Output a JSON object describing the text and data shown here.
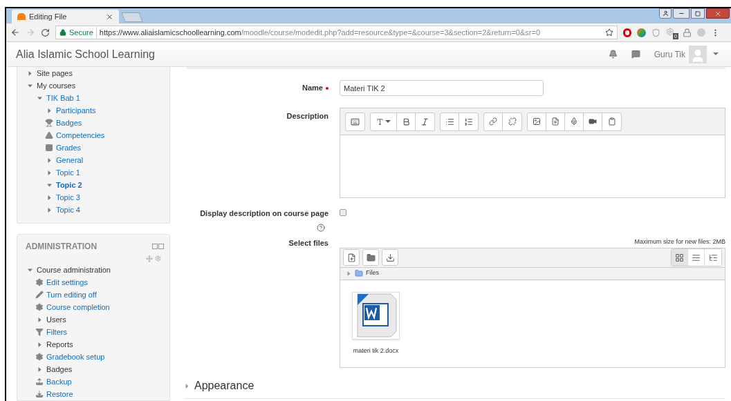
{
  "browser": {
    "tab_title": "Editing File",
    "secure_label": "Secure",
    "url_host": "https://www.aliaislamicschoollearning.com",
    "url_path": "/moodle/course/modedit.php?add=resource&type=&course=3&section=2&return=0&sr=0",
    "extension_badge": "0"
  },
  "site": {
    "title": "Alia Islamic School Learning",
    "user_name": "Guru Tik"
  },
  "navigation": [
    {
      "label": "Site pages",
      "kind": "node",
      "expanded": false,
      "link": false,
      "selected": false
    },
    {
      "label": "My courses",
      "kind": "node",
      "expanded": true,
      "link": false,
      "selected": false,
      "children": [
        {
          "label": "TIK Bab 1",
          "kind": "node",
          "expanded": true,
          "link": true,
          "selected": false,
          "children": [
            {
              "label": "Participants",
              "kind": "node",
              "expanded": false,
              "link": true,
              "selected": false
            },
            {
              "label": "Badges",
              "kind": "trophy",
              "link": true,
              "selected": false
            },
            {
              "label": "Competencies",
              "kind": "pyramid",
              "link": true,
              "selected": false
            },
            {
              "label": "Grades",
              "kind": "table",
              "link": true,
              "selected": false
            },
            {
              "label": "General",
              "kind": "node",
              "expanded": false,
              "link": true,
              "selected": false
            },
            {
              "label": "Topic 1",
              "kind": "node",
              "expanded": false,
              "link": true,
              "selected": false
            },
            {
              "label": "Topic 2",
              "kind": "node",
              "expanded": true,
              "link": true,
              "selected": true
            },
            {
              "label": "Topic 3",
              "kind": "node",
              "expanded": false,
              "link": true,
              "selected": false
            },
            {
              "label": "Topic 4",
              "kind": "node",
              "expanded": false,
              "link": true,
              "selected": false
            }
          ]
        }
      ]
    }
  ],
  "administration": {
    "title": "ADMINISTRATION",
    "items": [
      {
        "label": "Course administration",
        "kind": "node",
        "expanded": true,
        "link": false,
        "selected": false,
        "children": [
          {
            "label": "Edit settings",
            "kind": "gear",
            "link": true,
            "selected": false
          },
          {
            "label": "Turn editing off",
            "kind": "pencil",
            "link": true,
            "selected": false
          },
          {
            "label": "Course completion",
            "kind": "gear",
            "link": true,
            "selected": false
          },
          {
            "label": "Users",
            "kind": "node",
            "expanded": false,
            "link": false,
            "selected": false
          },
          {
            "label": "Filters",
            "kind": "funnel",
            "link": true,
            "selected": false
          },
          {
            "label": "Reports",
            "kind": "node",
            "expanded": false,
            "link": false,
            "selected": false
          },
          {
            "label": "Gradebook setup",
            "kind": "gear",
            "link": true,
            "selected": false
          },
          {
            "label": "Badges",
            "kind": "node",
            "expanded": false,
            "link": false,
            "selected": false
          },
          {
            "label": "Backup",
            "kind": "upload",
            "link": true,
            "selected": false
          },
          {
            "label": "Restore",
            "kind": "download",
            "link": true,
            "selected": false
          }
        ]
      }
    ]
  },
  "form": {
    "name": {
      "label": "Name",
      "required": true,
      "value": "Materi TIK 2"
    },
    "description": {
      "label": "Description"
    },
    "display_description": {
      "label": "Display description on course page",
      "checked": false
    },
    "select_files": {
      "label": "Select files",
      "max_size": "Maximum size for new files: 2MB",
      "folder": "Files",
      "views": [
        {
          "kind": "icons",
          "selected": true
        },
        {
          "kind": "list",
          "selected": false
        },
        {
          "kind": "tree",
          "selected": false
        }
      ],
      "files": [
        {
          "name": "materi tik 2.docx"
        }
      ]
    }
  },
  "appearance": {
    "title": "Appearance",
    "expanded": false
  }
}
